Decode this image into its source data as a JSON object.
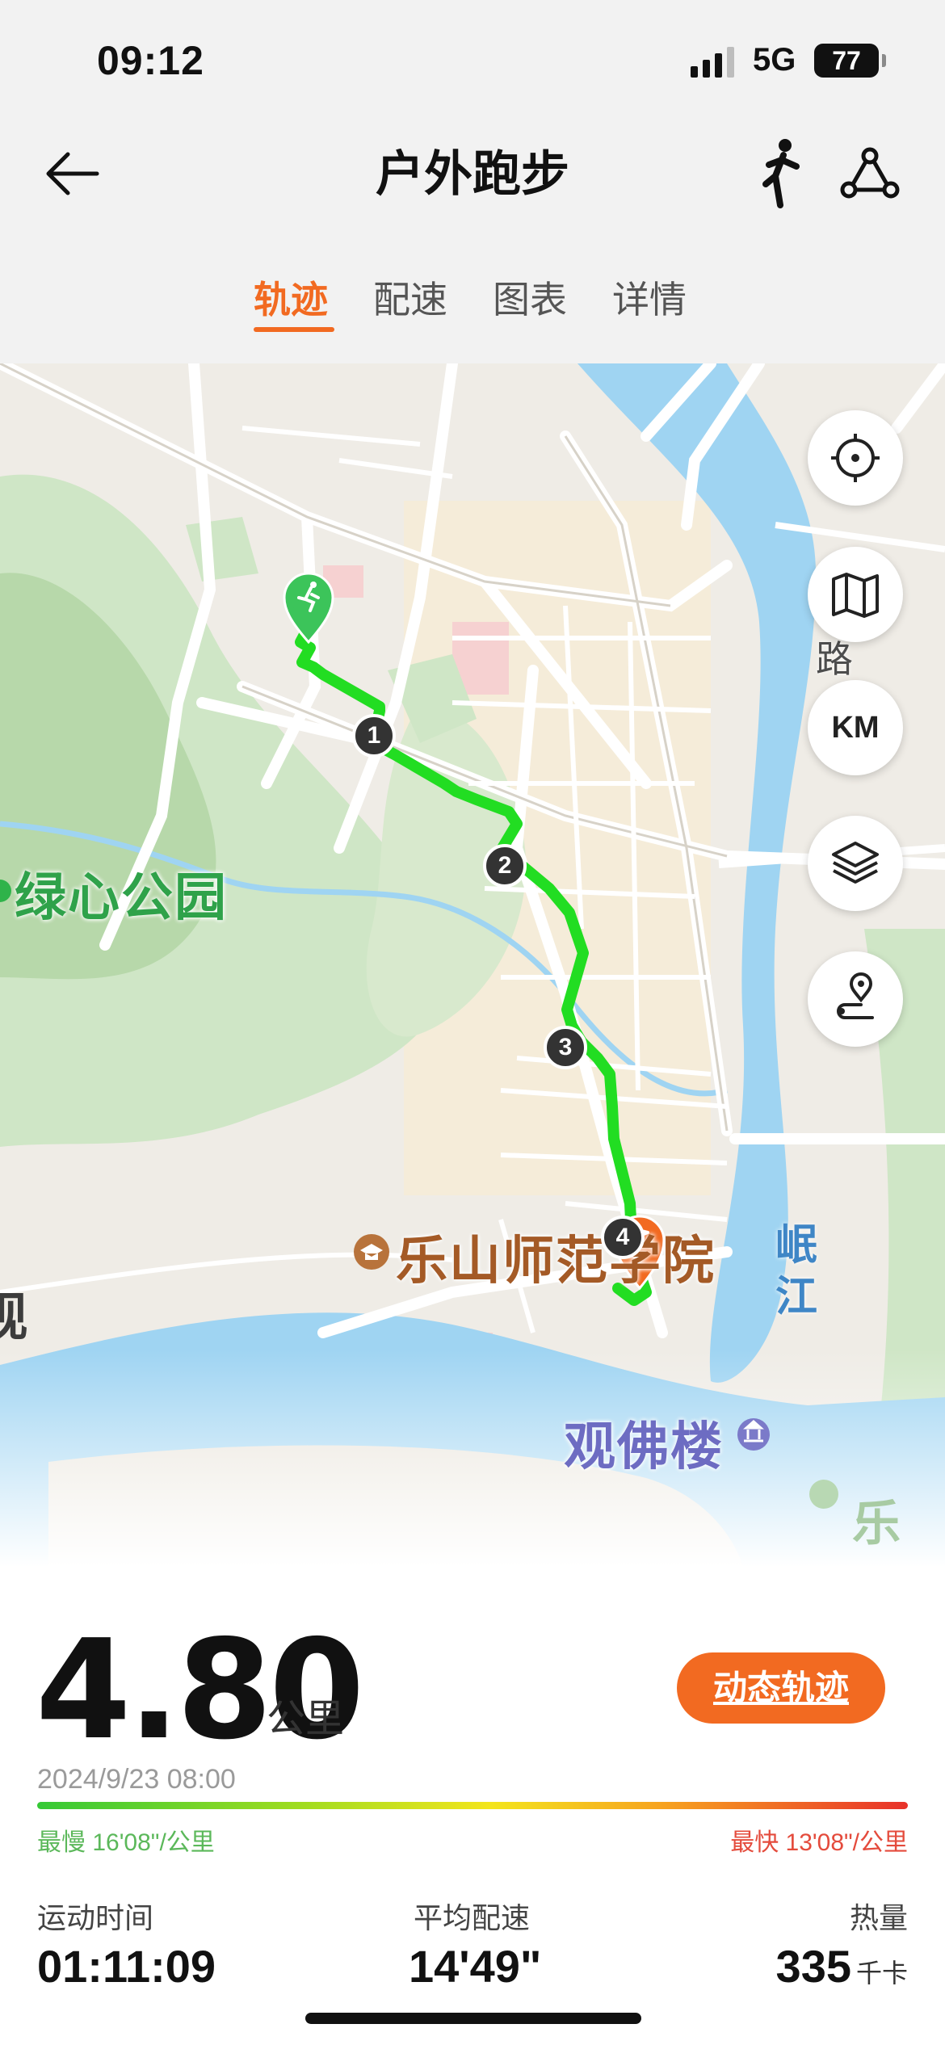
{
  "status_bar": {
    "time": "09:12",
    "network": "5G",
    "battery": "77"
  },
  "header": {
    "title": "户外跑步"
  },
  "tabs": [
    {
      "label": "轨迹",
      "active": true
    },
    {
      "label": "配速",
      "active": false
    },
    {
      "label": "图表",
      "active": false
    },
    {
      "label": "详情",
      "active": false
    }
  ],
  "map": {
    "labels": {
      "park": "绿心公园",
      "university": "乐山师范学院",
      "tower": "观佛楼",
      "river": "岷江",
      "road": "路",
      "partial_right": "乐山",
      "partial_left": "观"
    },
    "km_markers": [
      "1",
      "2",
      "3",
      "4"
    ],
    "controls": {
      "km": "KM"
    },
    "route_color": "#22dd22",
    "start_color": "#3cc45a",
    "finish_color": "#f26a21"
  },
  "stats": {
    "distance": "4.80",
    "distance_unit": "公里",
    "replay_button": "动态轨迹",
    "date": "2024/9/23 08:00",
    "slowest": "最慢 16'08\"/公里",
    "fastest": "最快 13'08\"/公里",
    "duration_label": "运动时间",
    "duration": "01:11:09",
    "avg_pace_label": "平均配速",
    "avg_pace": "14'49\"",
    "calories_label": "热量",
    "calories": "335",
    "calories_unit": "千卡"
  },
  "colors": {
    "accent": "#f26a21"
  }
}
